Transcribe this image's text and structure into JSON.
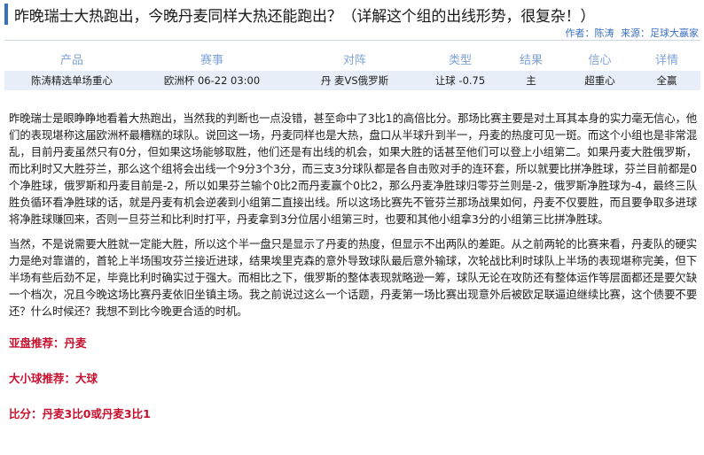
{
  "header": {
    "title": "昨晚瑞士大热跑出，今晚丹麦同样大热还能跑出？（详解这个组的出线形势，很复杂！）",
    "author": "作者：陈涛",
    "source": "来源：足球大赢家"
  },
  "table": {
    "columns": [
      "产品",
      "赛事",
      "对阵",
      "类型",
      "结果",
      "信心",
      "详情"
    ],
    "rows": [
      [
        "陈涛精选单场重心",
        "欧洲杯 06-22 03:00",
        "丹 麦VS俄罗斯",
        "让球 -0.75",
        "主",
        "超重心",
        "全赢"
      ]
    ]
  },
  "article": {
    "paragraphs": [
      "昨晚瑞士是眼睁睁地看着大热跑出，当然我的判断也一点没错，甚至命中了3比1的高倍比分。那场比赛主要是对土耳其本身的实力毫无信心，他们的表现堪称这届欧洲杯最糟糕的球队。说回这一场，丹麦同样也是大热，盘口从半球升到半一，丹麦的热度可见一斑。而这个小组也是非常混乱，目前丹麦虽然只有0分，但如果这场能够取胜，他们还是有出线的机会，如果大胜的话甚至他们可以登上小组第二。如果丹麦大胜俄罗斯，而比利时又大胜芬兰，那么这个组将会出线一个9分3个3分，而三支3分球队都是各自击败对手的连环套，所以就要比拼净胜球，芬兰目前都是0个净胜球，俄罗斯和丹麦目前是-2，所以如果芬兰输个0比2而丹麦赢个0比2，那么丹麦净胜球归零芬兰则是-2，俄罗斯净胜球为-4，最终三队胜负循环看净胜球的话，就是丹麦有机会逆袭到小组第二直接出线。所以这场比赛先不管芬兰那场战果如何，丹麦不仅要胜，而且要争取多进球将净胜球赚回来，否则一旦芬兰和比利时打平，丹麦拿到3分位居小组第三时，也要和其他小组拿3分的小组第三比拼净胜球。",
      "当然，不是说需要大胜就一定能大胜，所以这个半一盘只是显示了丹麦的热度，但显示不出两队的差距。从之前两轮的比赛来看，丹麦队的硬实力是绝对靠谱的，首轮上半场围攻芬兰接近进球，结果埃里克森的意外导致球队最后意外输球，次轮战比利时球队上半场的表现堪称完美，但下半场有些后劲不足，毕竟比利时确实过于强大。而相比之下，俄罗斯的整体表现就略逊一筹，球队无论在攻防还有整体运作等层面都还是要欠缺一个档次，况且今晚这场比赛丹麦依旧坐镇主场。我之前说过这么一个话题，丹麦第一场比赛出现意外后被欧足联逼迫继续比赛，这个债要不要还？什么时候还？我想不到比今晚更合适的时机。"
    ],
    "tips": [
      "亚盘推荐：丹麦",
      "大小球推荐：大球",
      "比分：丹麦3比0或丹麦3比1"
    ]
  },
  "colors": {
    "accent": "#3a6fc1",
    "header_text": "#7fa3d6",
    "row_background": "#e8eef8",
    "tip_red": "#c8102e"
  }
}
